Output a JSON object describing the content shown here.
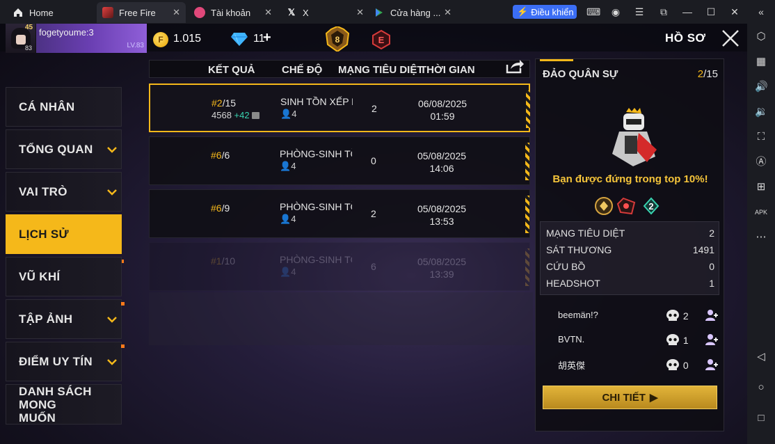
{
  "tabs": [
    {
      "label": "Home",
      "icon": "home-icon"
    },
    {
      "label": "Free Fire",
      "icon": "free-fire-icon"
    },
    {
      "label": "Tài khoản",
      "icon": "account-icon"
    },
    {
      "label": "X",
      "icon": "x-logo-icon"
    },
    {
      "label": "Cửa hàng ...",
      "icon": "play-store-icon"
    }
  ],
  "toolbar": {
    "control_label": "Điều khiển"
  },
  "player": {
    "name": "fogetyoume:3",
    "level_label": "LV.83",
    "badge_level": "83",
    "badge_top": "45"
  },
  "currency": {
    "gold": "1.015",
    "diamonds": "11",
    "plus": "+"
  },
  "ranks": {
    "br_tier": "8",
    "cs_letter": "E"
  },
  "header": {
    "title": "HỒ SƠ"
  },
  "menu": [
    {
      "label": "CÁ NHÂN"
    },
    {
      "label": "TỔNG QUAN"
    },
    {
      "label": "VAI TRÒ"
    },
    {
      "label": "LỊCH SỬ"
    },
    {
      "label": "VŨ KHÍ"
    },
    {
      "label": "TẬP ẢNH"
    },
    {
      "label": "ĐIỂM UY TÍN"
    },
    {
      "label": "DANH SÁCH MONG MUỐN"
    }
  ],
  "table": {
    "headers": {
      "result": "KẾT QUẢ",
      "mode": "CHẾ ĐỘ",
      "kills": "MẠNG TIÊU DIỆT",
      "time": "THỜI GIAN"
    },
    "rows": [
      {
        "place": "#2",
        "total": "/15",
        "score": "4568",
        "score_delta": "+42",
        "mode": "SINH TỒN XẾP HẠNG",
        "party": "4",
        "kills": "2",
        "date": "06/08/2025",
        "time": "01:59"
      },
      {
        "place": "#6",
        "total": "/6",
        "mode": "PHÒNG-SINH TỒN",
        "party": "4",
        "kills": "0",
        "date": "05/08/2025",
        "time": "14:06"
      },
      {
        "place": "#6",
        "total": "/9",
        "mode": "PHÒNG-SINH TỒN",
        "party": "4",
        "kills": "2",
        "date": "05/08/2025",
        "time": "13:53"
      },
      {
        "place": "#1",
        "total": "/10",
        "mode": "PHÒNG-SINH TỒN",
        "party": "4",
        "kills": "6",
        "date": "05/08/2025",
        "time": "13:39"
      }
    ]
  },
  "detail": {
    "map": "ĐẢO QUÂN SỰ",
    "place": "2",
    "total": "/15",
    "message": "Bạn được đứng trong top 10%!",
    "stats": [
      {
        "label": "MẠNG TIÊU DIỆT",
        "value": "2"
      },
      {
        "label": "SÁT THƯƠNG",
        "value": "1491"
      },
      {
        "label": "CỨU BỒ",
        "value": "0"
      },
      {
        "label": "HEADSHOT",
        "value": "1"
      }
    ],
    "teammates": [
      {
        "name": "beemän!?",
        "kills": "2"
      },
      {
        "name": "BVTN.",
        "kills": "1"
      },
      {
        "name": "胡英傑",
        "kills": "0"
      }
    ],
    "button": "CHI TIẾT"
  },
  "colors": {
    "accent": "#f5b81a",
    "score_up": "#39d3b0",
    "control": "#3b6ef5"
  }
}
